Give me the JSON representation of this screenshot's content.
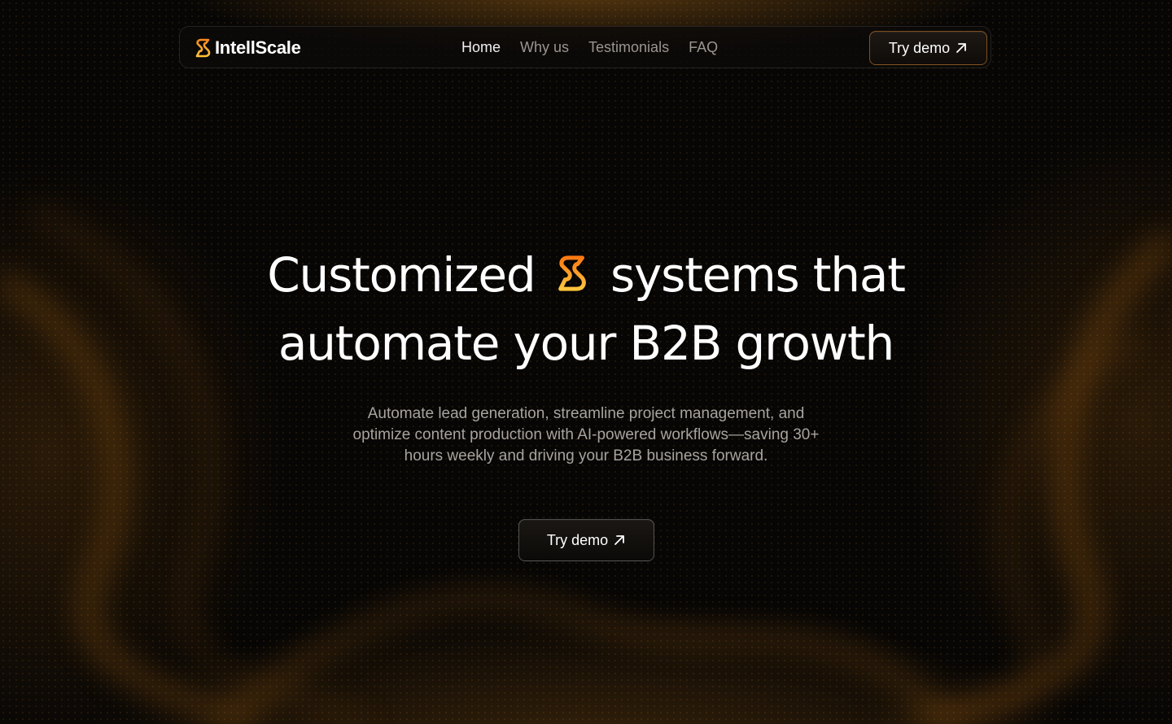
{
  "brand": {
    "name": "IntellScale",
    "logo_icon": "s-logo-icon",
    "accent_gradient": [
      "#ff8a1f",
      "#ffc23a"
    ]
  },
  "nav": {
    "links": [
      {
        "label": "Home",
        "active": true
      },
      {
        "label": "Why us",
        "active": false
      },
      {
        "label": "Testimonials",
        "active": false
      },
      {
        "label": "FAQ",
        "active": false
      }
    ],
    "cta_label": "Try demo",
    "cta_icon": "arrow-up-right-icon"
  },
  "hero": {
    "title_part1": "Customized",
    "title_part2": "systems that",
    "title_line2": "automate your B2B growth",
    "subtitle": "Automate lead generation, streamline project management, and optimize content production with AI-powered workflows—saving 30+ hours weekly and driving your B2B business forward.",
    "cta_label": "Try demo",
    "cta_icon": "arrow-up-right-icon"
  },
  "colors": {
    "background": "#070605",
    "accent": "#ff9a1f",
    "muted_text": "#a8a39e"
  }
}
